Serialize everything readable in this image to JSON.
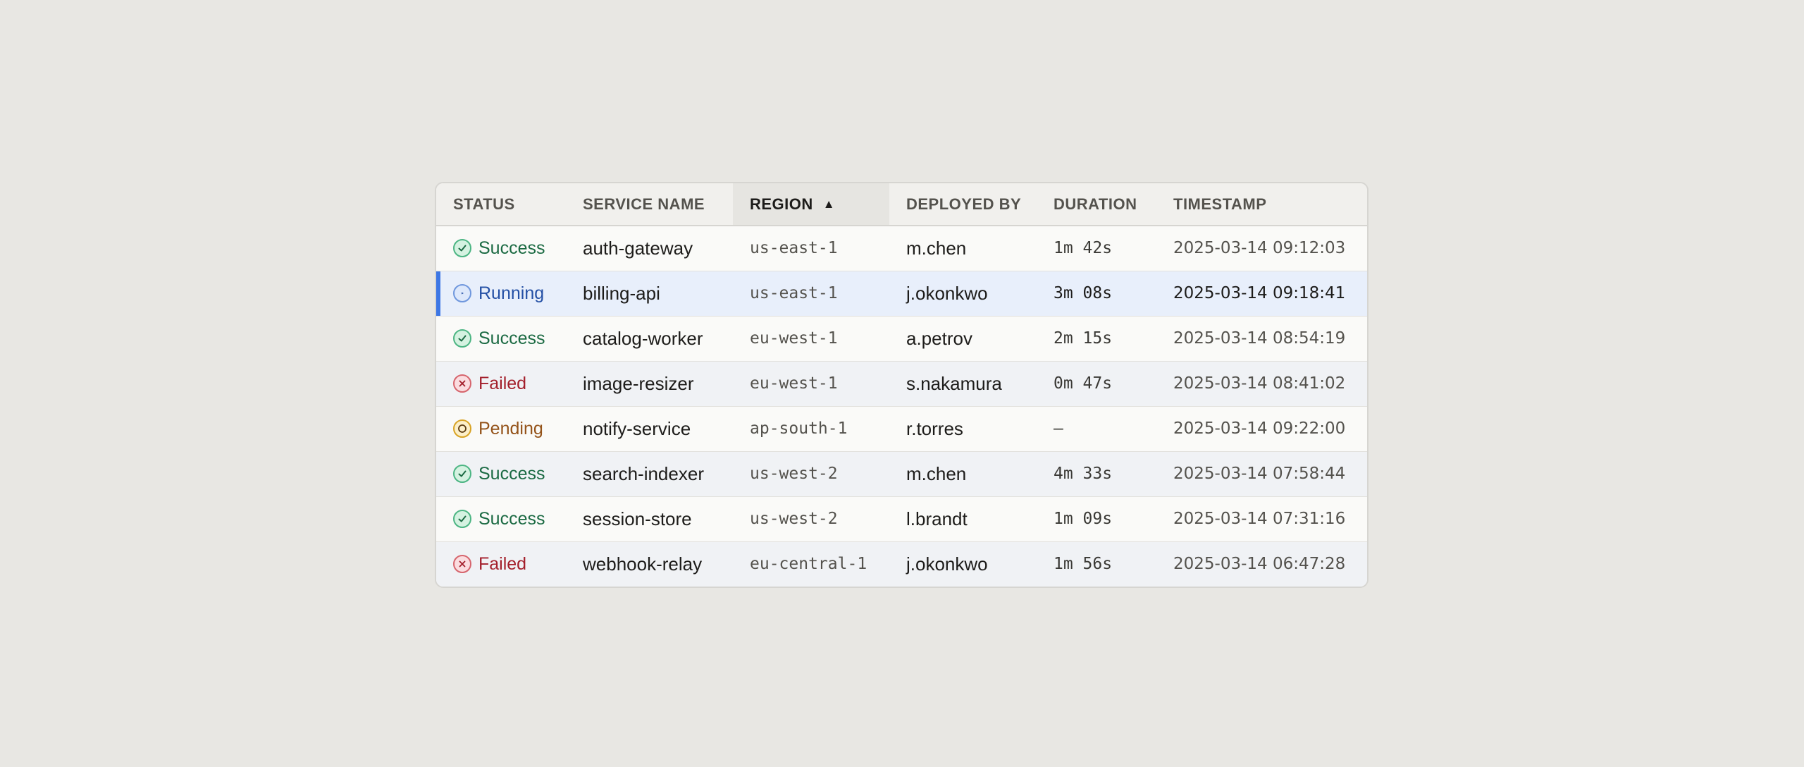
{
  "columns": {
    "status": "STATUS",
    "service_name": "SERVICE NAME",
    "region": "REGION",
    "deployed_by": "DEPLOYED BY",
    "duration": "DURATION",
    "timestamp": "TIMESTAMP"
  },
  "sort": {
    "column": "region",
    "direction": "ascending",
    "arrow": "▲"
  },
  "colors": {
    "success": "#1b6a43",
    "running": "#2450a5",
    "failed": "#a31f2b",
    "pending": "#94531a",
    "selected_accent": "#3d77e4"
  },
  "rows": [
    {
      "status": "Success",
      "status_icon": "check-icon",
      "service": "auth-gateway",
      "region": "us-east-1",
      "deployed_by": "m.chen",
      "duration": "1m 42s",
      "timestamp": "2025-03-14 09:12:03"
    },
    {
      "status": "Running",
      "status_icon": "play-icon",
      "service": "billing-api",
      "region": "us-east-1",
      "deployed_by": "j.okonkwo",
      "duration": "3m 08s",
      "timestamp": "2025-03-14 09:18:41",
      "selected": true
    },
    {
      "status": "Success",
      "status_icon": "check-icon",
      "service": "catalog-worker",
      "region": "eu-west-1",
      "deployed_by": "a.petrov",
      "duration": "2m 15s",
      "timestamp": "2025-03-14 08:54:19"
    },
    {
      "status": "Failed",
      "status_icon": "x-icon",
      "service": "image-resizer",
      "region": "eu-west-1",
      "deployed_by": "s.nakamura",
      "duration": "0m 47s",
      "timestamp": "2025-03-14 08:41:02"
    },
    {
      "status": "Pending",
      "status_icon": "circle-icon",
      "service": "notify-service",
      "region": "ap-south-1",
      "deployed_by": "r.torres",
      "duration": "—",
      "timestamp": "2025-03-14 09:22:00"
    },
    {
      "status": "Success",
      "status_icon": "check-icon",
      "service": "search-indexer",
      "region": "us-west-2",
      "deployed_by": "m.chen",
      "duration": "4m 33s",
      "timestamp": "2025-03-14 07:58:44"
    },
    {
      "status": "Success",
      "status_icon": "check-icon",
      "service": "session-store",
      "region": "us-west-2",
      "deployed_by": "l.brandt",
      "duration": "1m 09s",
      "timestamp": "2025-03-14 07:31:16"
    },
    {
      "status": "Failed",
      "status_icon": "x-icon",
      "service": "webhook-relay",
      "region": "eu-central-1",
      "deployed_by": "j.okonkwo",
      "duration": "1m 56s",
      "timestamp": "2025-03-14 06:47:28"
    }
  ]
}
